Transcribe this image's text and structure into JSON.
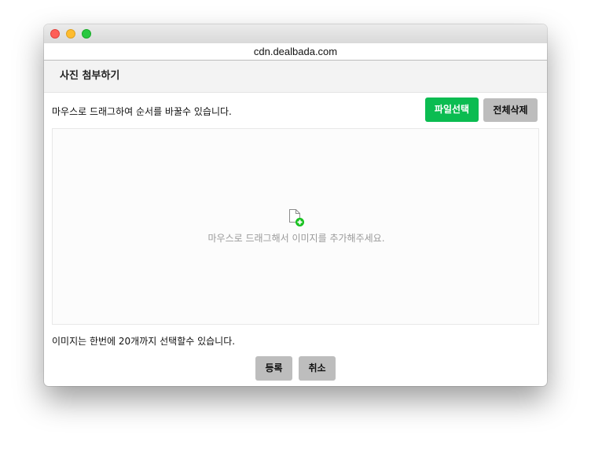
{
  "browser": {
    "url": "cdn.dealbada.com"
  },
  "popup": {
    "title": "사진 첨부하기",
    "drag_hint": "마우스로 드래그하여 순서를 바꿀수 있습니다.",
    "file_select_label": "파일선택",
    "delete_all_label": "전체삭제",
    "dropzone_text": "마우스로 드래그해서 이미지를 추가해주세요.",
    "limit_hint": "이미지는 한번에 20개까지 선택할수 있습니다.",
    "register_label": "등록",
    "cancel_label": "취소"
  },
  "icons": {
    "dropzone_icon": "add-file-icon"
  },
  "colors": {
    "primary_button": "#0bbc51",
    "secondary_button": "#bdbdbd",
    "icon_accent": "#17c11f"
  }
}
